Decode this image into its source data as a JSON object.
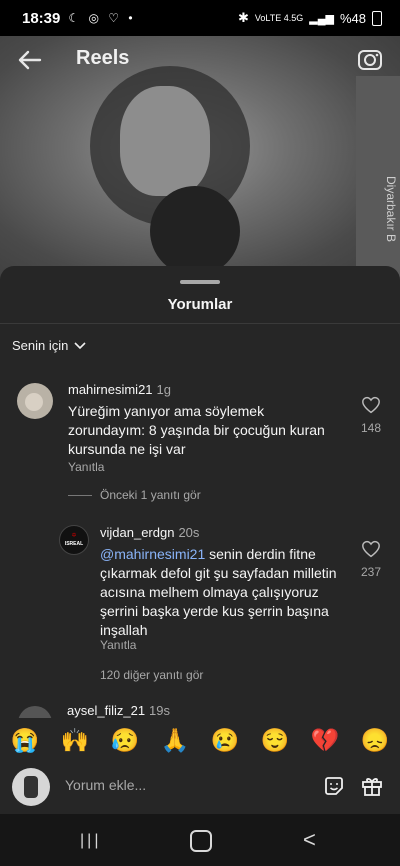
{
  "status": {
    "time": "18:39",
    "left_icons": "☾ ◎ ♡ •",
    "network": "VoLTE 4.5G",
    "battery": "%48"
  },
  "header": {
    "title": "Reels"
  },
  "video": {
    "watermark": "Diyarbakır B"
  },
  "sheet": {
    "title": "Yorumlar",
    "filter_label": "Senin için"
  },
  "comments": [
    {
      "username": "mahirnesimi21",
      "time": "1g",
      "text": "Yüreğim yanıyor ama söylemek zorundayım: 8 yaşında bir çocuğun kuran kursunda ne işi var",
      "reply_label": "Yanıtla",
      "likes": "148",
      "more_replies": "Önceki 1 yanıtı gör"
    },
    {
      "username": "vijdan_erdgn",
      "time": "20s",
      "mention": "@mahirnesimi21",
      "text": " senin derdin fitne çıkarmak defol git şu sayfadan milletin acısına melhem olmaya çalışıyoruz şerrini başka yerde kus şerrin başına inşallah",
      "reply_label": "Yanıtla",
      "likes": "237",
      "more_replies": "120 diğer yanıtı gör"
    },
    {
      "username": "aysel_filiz_21",
      "time": "19s"
    }
  ],
  "reactions": [
    "😭",
    "🙌",
    "😥",
    "🙏",
    "😢",
    "😌",
    "💔",
    "😞"
  ],
  "composer": {
    "placeholder": "Yorum ekle..."
  },
  "navbar": {
    "recent": "|||",
    "back": "<"
  }
}
